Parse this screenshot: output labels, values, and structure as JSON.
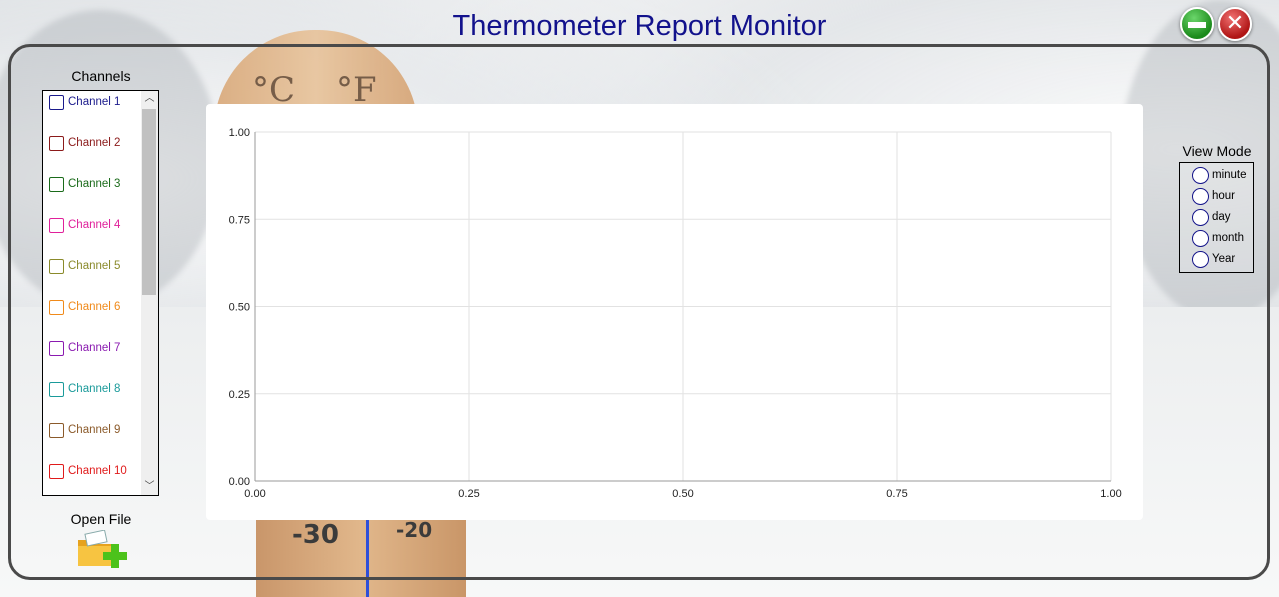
{
  "app": {
    "title": "Thermometer Report Monitor"
  },
  "window_controls": {
    "minimize_icon": "minimize-icon",
    "close_icon": "close-icon"
  },
  "decor": {
    "unit_c": "°C",
    "unit_f": "°F",
    "scale_left": "-30",
    "scale_right": "-20"
  },
  "channels": {
    "title": "Channels",
    "items": [
      {
        "label": "Channel 1",
        "color": "#1a1a8c",
        "checked": false
      },
      {
        "label": "Channel 2",
        "color": "#8b1a1a",
        "checked": false
      },
      {
        "label": "Channel 3",
        "color": "#1a6b1a",
        "checked": false
      },
      {
        "label": "Channel 4",
        "color": "#e0209a",
        "checked": false
      },
      {
        "label": "Channel 5",
        "color": "#8a8a2a",
        "checked": false
      },
      {
        "label": "Channel 6",
        "color": "#f08a1a",
        "checked": false
      },
      {
        "label": "Channel 7",
        "color": "#8a1ab0",
        "checked": false
      },
      {
        "label": "Channel 8",
        "color": "#1a9a9a",
        "checked": false
      },
      {
        "label": "Channel 9",
        "color": "#8b5a2a",
        "checked": false
      },
      {
        "label": "Channel 10",
        "color": "#e01a1a",
        "checked": false
      }
    ]
  },
  "open_file": {
    "label": "Open File",
    "icon": "folder-add-icon"
  },
  "view_mode": {
    "title": "View Mode",
    "options": [
      "minute",
      "hour",
      "day",
      "month",
      "Year"
    ],
    "selected": null
  },
  "chart_data": {
    "type": "line",
    "series": [],
    "xlim": [
      0,
      1
    ],
    "ylim": [
      0,
      1
    ],
    "x_ticks": [
      "0.00",
      "0.25",
      "0.50",
      "0.75",
      "1.00"
    ],
    "y_ticks": [
      "0.00",
      "0.25",
      "0.50",
      "0.75",
      "1.00"
    ],
    "grid": true
  }
}
